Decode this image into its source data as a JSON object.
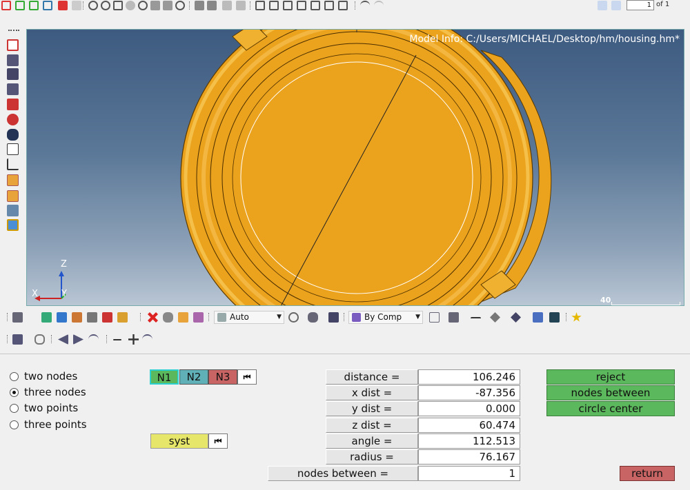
{
  "toolbar": {
    "page_value": "1",
    "page_of": "of 1"
  },
  "viewport": {
    "model_info": "Model Info: C:/Users/MICHAEL/Desktop/hm/housing.hm*",
    "triad_z": "Z",
    "triad_x": "X",
    "triad_y": "Y",
    "scale_value": "40"
  },
  "mid_toolbar": {
    "auto_select": "Auto",
    "by_comp_select": "By Comp"
  },
  "panel": {
    "radio_options": [
      {
        "label": "two nodes",
        "selected": false
      },
      {
        "label": "three nodes",
        "selected": true
      },
      {
        "label": "two points",
        "selected": false
      },
      {
        "label": "three points",
        "selected": false
      }
    ],
    "node_buttons": [
      "N1",
      "N2",
      "N3"
    ],
    "syst_label": "syst",
    "skip_icon": "⏮",
    "measurements": [
      {
        "label": "distance =",
        "value": "106.246"
      },
      {
        "label": "x dist   =",
        "value": "-87.356"
      },
      {
        "label": "y dist   =",
        "value": "0.000"
      },
      {
        "label": "z dist   =",
        "value": "60.474"
      },
      {
        "label": "angle   =",
        "value": "112.513"
      },
      {
        "label": "radius   =",
        "value": "76.167"
      },
      {
        "label": "nodes between  =",
        "value": "1"
      }
    ],
    "action_buttons": {
      "reject": "reject",
      "nodes_between": "nodes  between",
      "circle_center": "circle  center",
      "return": "return"
    }
  },
  "colors": {
    "model_orange": "#eba21c",
    "n1": "#5cb85c",
    "n2": "#5fb0b7",
    "n3": "#c86464",
    "syst": "#e6e66a",
    "green_button": "#5cb85c",
    "return_button": "#c86464"
  }
}
